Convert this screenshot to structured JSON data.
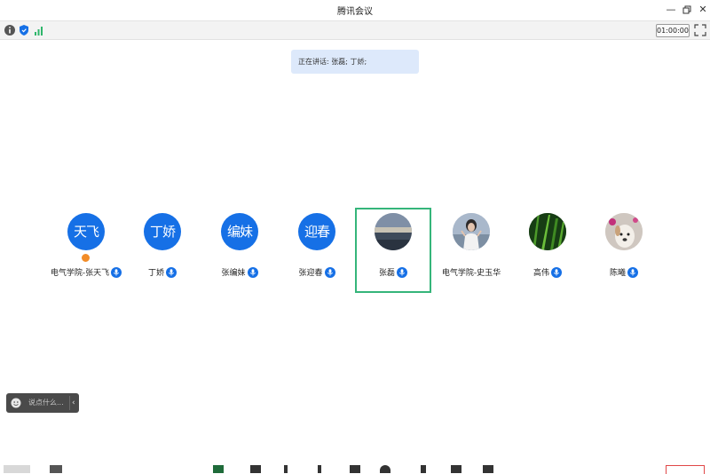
{
  "window": {
    "title": "腾讯会议"
  },
  "toolbar": {
    "timer": "01:00:00",
    "icons": [
      "info-icon",
      "shield-icon",
      "signal-icon",
      "fullscreen-icon"
    ]
  },
  "speaking_banner": {
    "text": "正在讲话: 张磊; 丁娇;"
  },
  "participants": [
    {
      "name": "电气学院-张天飞",
      "avatar_text": "天飞",
      "avatar_type": "text",
      "hand_raised": true
    },
    {
      "name": "丁娇",
      "avatar_text": "丁娇",
      "avatar_type": "text"
    },
    {
      "name": "张编妹",
      "avatar_text": "编妹",
      "avatar_type": "text"
    },
    {
      "name": "张迎春",
      "avatar_text": "迎春",
      "avatar_type": "text"
    },
    {
      "name": "张磊",
      "avatar_text": "",
      "avatar_type": "photo-sea",
      "selected": true
    },
    {
      "name": "电气学院-史玉华",
      "avatar_text": "",
      "avatar_type": "photo-person"
    },
    {
      "name": "高伟",
      "avatar_text": "",
      "avatar_type": "photo-grass"
    },
    {
      "name": "陈曦",
      "avatar_text": "",
      "avatar_type": "photo-dog"
    }
  ],
  "chat": {
    "placeholder": "说点什么..."
  },
  "colors": {
    "avatar_blue": "#1670e6",
    "selected_border": "#35b57a",
    "banner_bg": "#dde9fb",
    "mic_blue": "#1670e6"
  }
}
